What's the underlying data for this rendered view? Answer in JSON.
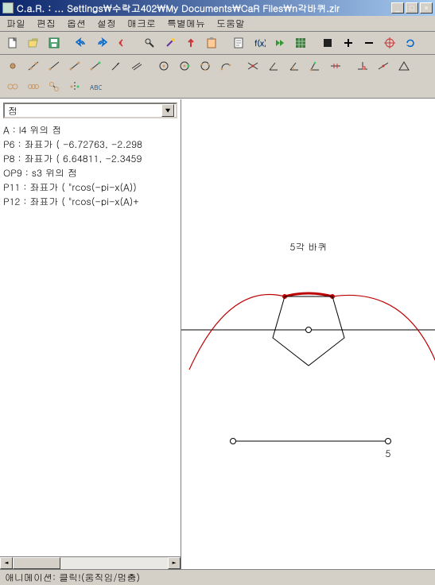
{
  "window": {
    "title": "C.a.R. : ...  Settings\\수락고402\\My Documents\\CaR Files\\n각바퀴.zir"
  },
  "menu": {
    "file": "파일",
    "edit": "편집",
    "options": "옵션",
    "settings": "설정",
    "macro": "매크로",
    "special": "특별메뉴",
    "help": "도움말"
  },
  "combo": {
    "selected": "점"
  },
  "objects": [
    "A : l4 위의 점",
    "P6 : 좌표가 ( -6.72763, -2.298",
    "P8 : 좌표가 ( 6.64811, -2.3459",
    "OP9 : s3 위의 점",
    "P11 : 좌표가 ( \"rcos(-pi-x(A))",
    "P12 : 좌표가 ( \"rcos(-pi-x(A)+"
  ],
  "canvas": {
    "title_label": "5각 바퀴",
    "axis_label": "5"
  },
  "status": {
    "text": "애니메이션: 클릭!(움직임/멈춤)"
  },
  "toolbar_icons": {
    "r1": [
      "new",
      "open",
      "save",
      "undo",
      "redo",
      "prev",
      "tools",
      "wand",
      "arrow-up",
      "paste",
      "note",
      "fx",
      "play-fwd",
      "grid",
      "stop",
      "plus",
      "minus",
      "target",
      "refresh"
    ],
    "r2": [
      "point",
      "line",
      "ray",
      "segment",
      "seg2",
      "vec",
      "para",
      "circ1",
      "circ2",
      "circ3",
      "arc",
      "int",
      "angle",
      "ang2",
      "ang3",
      "mark",
      "perp",
      "mid",
      "tri",
      "link",
      "chain",
      "chain2",
      "sym",
      "abc"
    ]
  }
}
